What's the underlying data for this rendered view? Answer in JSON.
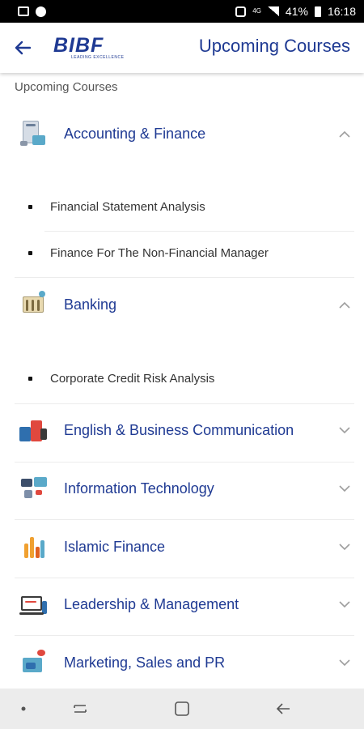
{
  "status_bar": {
    "battery_percent": "41%",
    "time": "16:18",
    "network": "4G"
  },
  "app_bar": {
    "logo_text": "BIBF",
    "logo_tagline": "LEADING EXCELLENCE",
    "title": "Upcoming Courses"
  },
  "section_caption": "Upcoming Courses",
  "categories": [
    {
      "label": "Accounting & Finance",
      "icon": "accounting-finance-icon",
      "expanded": true,
      "courses": [
        "Financial Statement Analysis",
        "Finance For The Non-Financial Manager"
      ]
    },
    {
      "label": "Banking",
      "icon": "banking-icon",
      "expanded": true,
      "courses": [
        "Corporate Credit Risk Analysis"
      ]
    },
    {
      "label": "English & Business Communication",
      "icon": "communication-icon",
      "expanded": false,
      "courses": []
    },
    {
      "label": "Information Technology",
      "icon": "information-technology-icon",
      "expanded": false,
      "courses": []
    },
    {
      "label": "Islamic Finance",
      "icon": "islamic-finance-icon",
      "expanded": false,
      "courses": []
    },
    {
      "label": "Leadership & Management",
      "icon": "leadership-icon",
      "expanded": false,
      "courses": []
    },
    {
      "label": "Marketing, Sales and PR",
      "icon": "marketing-icon",
      "expanded": false,
      "courses": []
    }
  ],
  "colors": {
    "brand": "#1f3a93",
    "divider": "#ececec",
    "nav_bar": "#ececec"
  }
}
